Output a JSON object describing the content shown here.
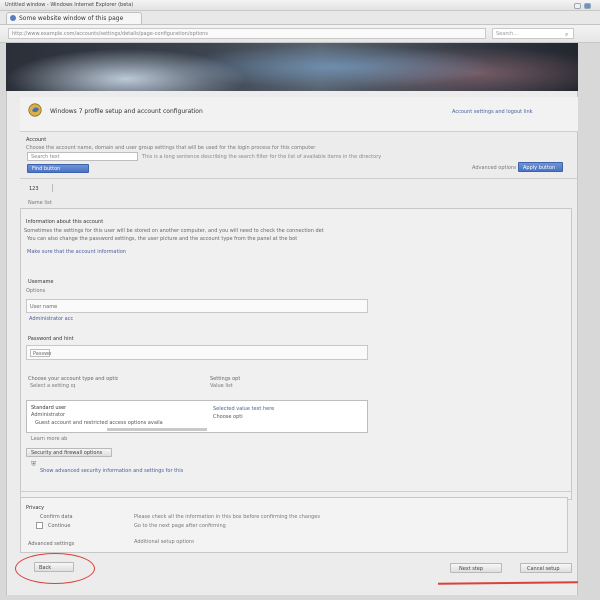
{
  "window": {
    "title": "Untitled window - Windows Internet Explorer (beta)"
  },
  "browser": {
    "tab_title": "Some website window of this page",
    "address": "http://www.example.com/accounts/settings/details/page-configuration/options",
    "search_placeholder": "Search..."
  },
  "header": {
    "title": "Windows 7 profile setup and account configuration",
    "right_link": "Account settings and logout link"
  },
  "section1": {
    "label": "Account",
    "long_line": "Choose the account name, domain and user group settings that will be used for the login process for this computer",
    "search_value": "Search text",
    "search_hint": "This is a long sentence describing the search filter for the list of available items in the directory",
    "blue_button": "Find button",
    "right_hint": "Advanced options",
    "right_blue_button": "Apply button"
  },
  "list": {
    "count_label": "123",
    "sub_label": "Name list"
  },
  "description": {
    "heading": "Information about this account",
    "lines": [
      "Sometimes the settings for this user will be stored on another computer, and you will need to check the connection details before continuing",
      "You can also change the password settings, the user picture and the account type from the panel at the bottom of this page",
      "Make sure that the account information is correct before continuing with the setup"
    ]
  },
  "group1": {
    "title": "Username",
    "subtitle": "Options",
    "row_label": "User name",
    "row_sub": "Administrator access"
  },
  "group2": {
    "title": "Password and hint",
    "field_value": "Password"
  },
  "group3": {
    "left_label": "Choose your account type and options",
    "left_sub": "Select a setting option",
    "right_label": "Settings option",
    "right_sub": "Value list",
    "list_rows": [
      "Standard user",
      "Administrator",
      "Guest account and restricted access options available here"
    ],
    "list_right_rows": [
      "Selected value text here",
      "Choose option"
    ],
    "footer_note": "Learn more about this"
  },
  "security": {
    "label": "Security and firewall options",
    "sub": "Show advanced security information and settings for this account here"
  },
  "bottom": {
    "group_title": "Privacy",
    "row1_label": "Confirm data",
    "row1_text": "Please check all the information in this box before confirming the changes",
    "row2_label": "Continue",
    "row2_text": "Go to the next page after confirming",
    "row3_label": "Advanced settings",
    "row3_text": "Additional setup options"
  },
  "footer": {
    "back_button": "Back",
    "next_button": "Next step",
    "cancel_button": "Cancel setup"
  },
  "colors": {
    "accent_blue": "#4a74c4",
    "annotation_red": "#d9413a",
    "link": "#4a5f9a"
  }
}
